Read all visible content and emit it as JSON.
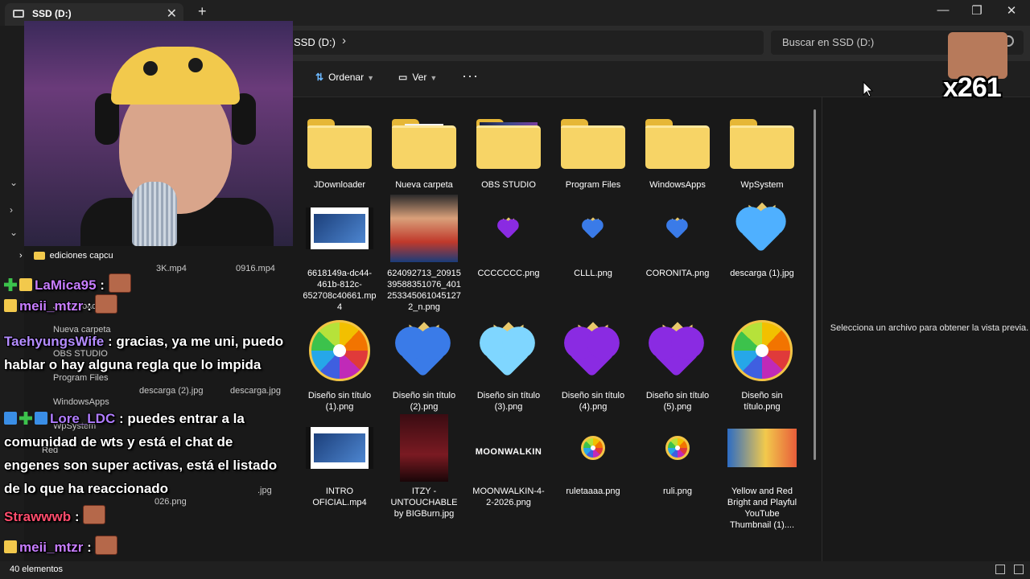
{
  "window": {
    "tab_title": "SSD (D:)",
    "close_tab": "✕",
    "new_tab": "+",
    "minimize": "—",
    "maximize": "❐",
    "close": "✕"
  },
  "address": {
    "path": "SSD (D:)",
    "path_chevron": "›",
    "search_placeholder": "Buscar en SSD (D:)"
  },
  "toolbar": {
    "sort_label": "Ordenar",
    "view_label": "Ver",
    "more_label": "···"
  },
  "folders": [
    {
      "name": "JDownloader",
      "style": "plain"
    },
    {
      "name": "Nueva carpeta",
      "style": "paper"
    },
    {
      "name": "OBS STUDIO",
      "style": "shot"
    },
    {
      "name": "Program Files",
      "style": "plain"
    },
    {
      "name": "WindowsApps",
      "style": "plain"
    },
    {
      "name": "WpSystem",
      "style": "plain"
    }
  ],
  "files_row2": [
    {
      "name": "6618149a-dc44-461b-812c-652708c40661.mp4",
      "kind": "video"
    },
    {
      "name": "624092713_2091539588351076_4012533450610451272_n.png",
      "kind": "photo"
    },
    {
      "name": "CCCCCCC.png",
      "kind": "heart-purple-small"
    },
    {
      "name": "CLLL.png",
      "kind": "heart-blue-small"
    },
    {
      "name": "CORONITA.png",
      "kind": "heart-blue-small"
    },
    {
      "name": "descarga (1).jpg",
      "kind": "heart-pink"
    }
  ],
  "files_row3": [
    {
      "name": "Diseño sin título (1).png",
      "kind": "wheel"
    },
    {
      "name": "Diseño sin título (2).png",
      "kind": "heart-blue"
    },
    {
      "name": "Diseño sin título (3).png",
      "kind": "heart-lightblue"
    },
    {
      "name": "Diseño sin título (4).png",
      "kind": "heart-purple"
    },
    {
      "name": "Diseño sin título (5).png",
      "kind": "heart-purple"
    },
    {
      "name": "Diseño sin título.png",
      "kind": "wheel"
    }
  ],
  "files_row4": [
    {
      "name": "INTRO OFICIAL.mp4",
      "kind": "video"
    },
    {
      "name": "ITZY - UNTOUCHABLE by BIGBurn.jpg",
      "kind": "photo-dark"
    },
    {
      "name": "MOONWALKIN-4-2-2026.png",
      "kind": "moonwalkin"
    },
    {
      "name": "ruletaaaa.png",
      "kind": "wheel-small"
    },
    {
      "name": "ruli.png",
      "kind": "wheel-small"
    },
    {
      "name": "Yellow and Red Bright and Playful YouTube Thumbnail (1)....",
      "kind": "thumb"
    }
  ],
  "moonwalkin_text": "MOONWALKIN",
  "preview_text": "Selecciona un archivo para obtener la vista previa.",
  "status": {
    "count": "40 elementos"
  },
  "sidebar": {
    "edc_label": "ediciones capcu",
    "ghost_labels": [
      "JDownloader",
      "Nueva carpeta",
      "OBS STUDIO",
      "Program Files",
      "WindowsApps",
      "WpSystem",
      "Red"
    ],
    "ghost_files": [
      "3K.mp4",
      "0916.mp4",
      "descarga (2).jpg",
      "descarga.jpg",
      "026.png",
      ".jpg"
    ]
  },
  "chat": [
    {
      "user": "LaMica95",
      "user_color": "#c77dff",
      "text": "",
      "badges": [
        "green",
        "crown"
      ],
      "emote": true
    },
    {
      "user": "meii_mtzr",
      "user_color": "#c77dff",
      "text": "",
      "badges": [
        "crown"
      ],
      "emote": true
    },
    {
      "user": "TaehyungsWife",
      "user_color": "#b48cff",
      "text": "gracias, ya me uni, puedo hablar o hay alguna regla que lo impida",
      "badges": [],
      "emote": false
    },
    {
      "user": "Lore_LDC",
      "user_color": "#b07cff",
      "text": "puedes entrar a la comunidad de wts y está el chat de engenes son super activas, está el listado de lo que ha reaccionado",
      "badges": [
        "blue",
        "green",
        "blue"
      ],
      "emote": false
    },
    {
      "user": "Strawwwb",
      "user_color": "#ff4d6d",
      "text": "",
      "badges": [],
      "emote": true
    },
    {
      "user": "meii_mtzr",
      "user_color": "#c77dff",
      "text": "",
      "badges": [
        "crown"
      ],
      "emote": true
    }
  ],
  "overlay": {
    "counter": "x261"
  }
}
